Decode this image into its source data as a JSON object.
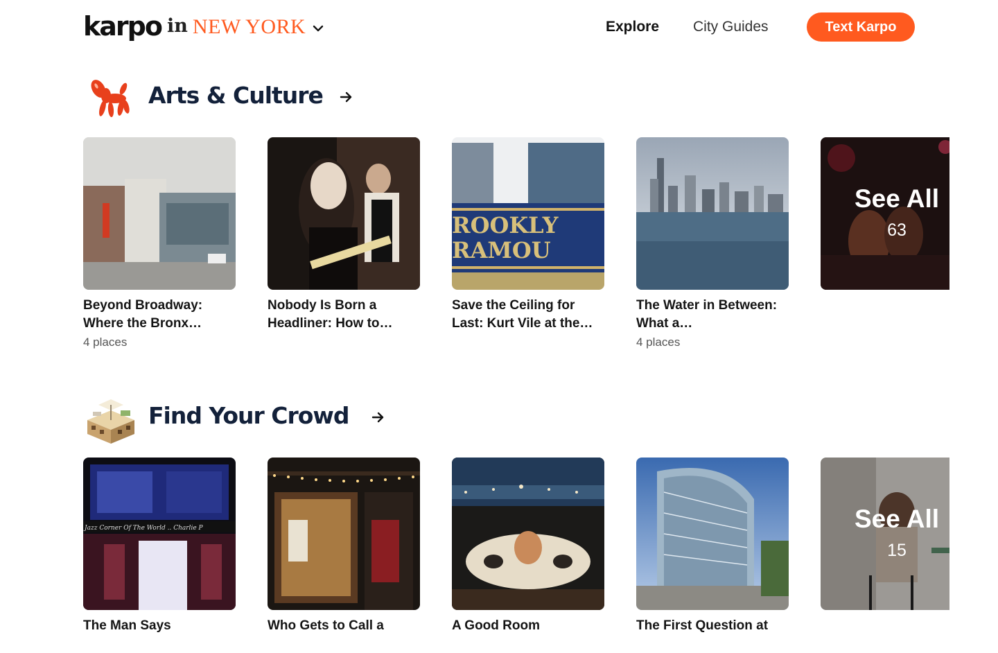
{
  "header": {
    "logo": "karpo",
    "in_label": "in",
    "city": "NEW YORK",
    "nav": {
      "explore": "Explore",
      "city_guides": "City Guides"
    },
    "cta": "Text Karpo"
  },
  "colors": {
    "accent": "#ff5a1f",
    "title": "#13213a"
  },
  "sections": [
    {
      "icon": "balloon-dog-icon",
      "title": "Arts & Culture",
      "cards": [
        {
          "title": "Beyond Broadway: Where the Bronx…",
          "count": "4 places"
        },
        {
          "title": "Nobody Is Born a Headliner: How to…",
          "count": ""
        },
        {
          "title": "Save the Ceiling for Last: Kurt Vile at the…",
          "count": ""
        },
        {
          "title": "The Water in Between: What a…",
          "count": "4 places"
        }
      ],
      "see_all": {
        "label": "See All",
        "count": "63"
      }
    },
    {
      "icon": "rooftop-building-icon",
      "title": "Find Your Crowd",
      "cards": [
        {
          "title": "The Man Says",
          "count": ""
        },
        {
          "title": "Who Gets to Call a",
          "count": ""
        },
        {
          "title": "A Good Room",
          "count": ""
        },
        {
          "title": "The First Question at",
          "count": ""
        }
      ],
      "see_all": {
        "label": "See All",
        "count": "15"
      }
    }
  ]
}
